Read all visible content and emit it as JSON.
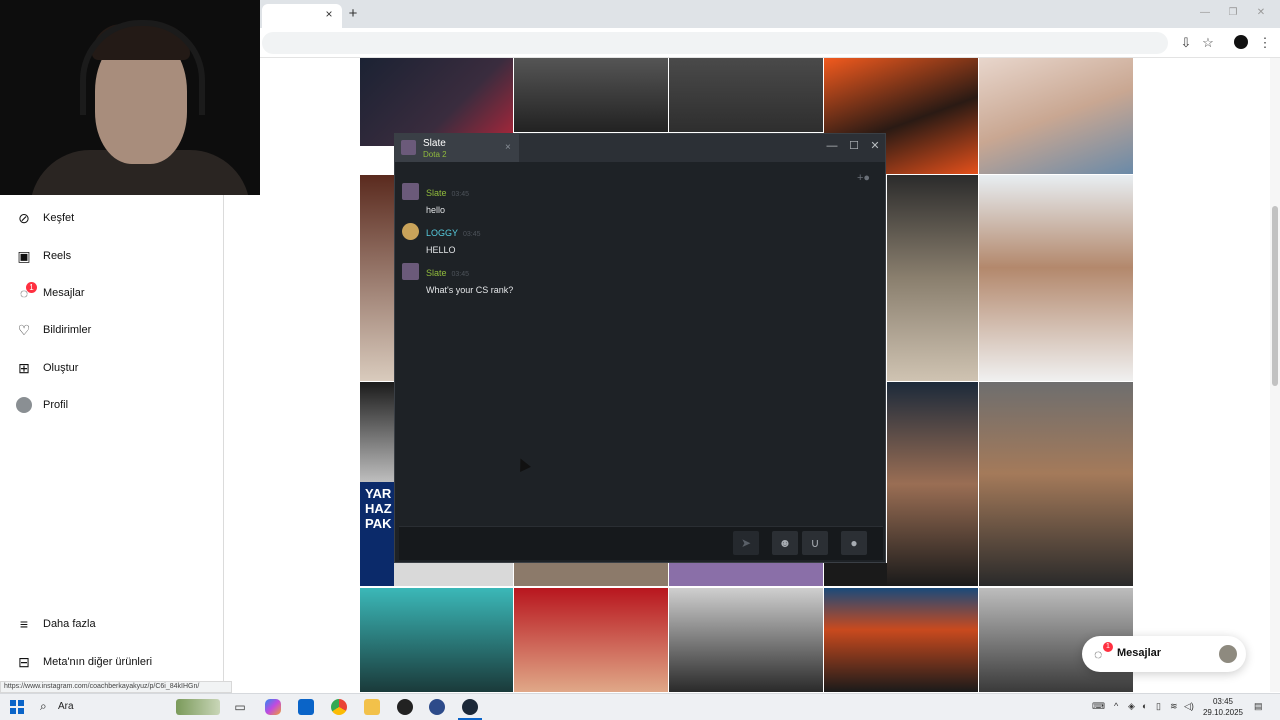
{
  "browser": {
    "tab_close": "×",
    "new_tab": "+",
    "status_url": "https://www.instagram.com/coachberkayakyuz/p/C6i_84kIHGn/"
  },
  "sidebar": {
    "items": [
      {
        "label": "Keşfet",
        "icon": "compass-icon"
      },
      {
        "label": "Reels",
        "icon": "reels-icon"
      },
      {
        "label": "Mesajlar",
        "icon": "messenger-icon",
        "badge": "1"
      },
      {
        "label": "Bildirimler",
        "icon": "heart-icon"
      },
      {
        "label": "Oluştur",
        "icon": "plus-square-icon"
      },
      {
        "label": "Profil",
        "icon": "avatar"
      }
    ],
    "more": "Daha fazla",
    "meta": "Meta'nın diğer ürünleri"
  },
  "steam_chat": {
    "friend_name": "Slate",
    "friend_game": "Dota 2",
    "messages": [
      {
        "author": "Slate",
        "time": "03:45",
        "text": "hello",
        "color": "#90ba3c"
      },
      {
        "author": "LOGGY",
        "time": "03:45",
        "text": "HELLO",
        "color": "#57cbde"
      },
      {
        "author": "Slate",
        "time": "03:45",
        "text": "What's your CS rank?",
        "color": "#90ba3c"
      }
    ]
  },
  "grid_tile_text": {
    "yarisma_lines": [
      "YAR",
      "HAZ",
      "PAK"
    ]
  },
  "messages_pill": {
    "label": "Mesajlar",
    "badge": "1"
  },
  "taskbar": {
    "search_label": "Ara",
    "time": "03:45",
    "date": "29.10.2025"
  },
  "colors": {
    "steam_bg": "#1e2226",
    "steam_green": "#90ba3c",
    "steam_blue": "#57cbde",
    "instagram_red": "#ff3040"
  }
}
